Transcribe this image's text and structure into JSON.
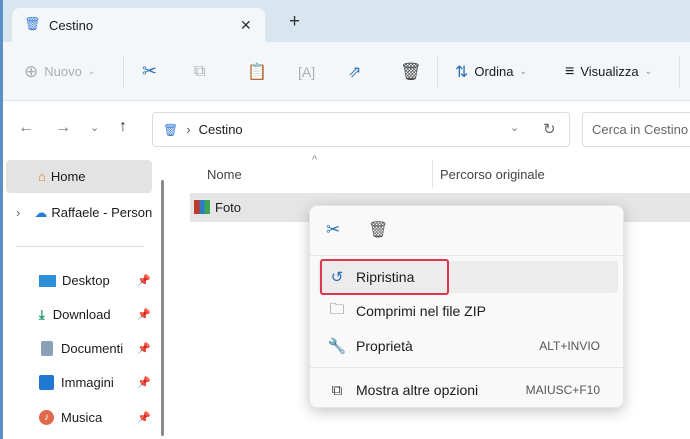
{
  "tab": {
    "title": "Cestino",
    "close": "✕",
    "new_tab": "+"
  },
  "toolbar": {
    "new_label": "Nuovo",
    "sort_label": "Ordina",
    "view_label": "Visualizza"
  },
  "address": {
    "path": "Cestino",
    "search_placeholder": "Cerca in Cestino"
  },
  "sidebar": {
    "items": [
      {
        "label": "Home"
      },
      {
        "label": "Raffaele - Personale"
      },
      {
        "label": "Desktop"
      },
      {
        "label": "Download"
      },
      {
        "label": "Documenti"
      },
      {
        "label": "Immagini"
      },
      {
        "label": "Musica"
      }
    ]
  },
  "columns": {
    "name": "Nome",
    "original_path": "Percorso originale"
  },
  "files": [
    {
      "name": "Foto"
    }
  ],
  "context_menu": {
    "items": [
      {
        "label": "Ripristina",
        "shortcut": ""
      },
      {
        "label": "Comprimi nel file ZIP",
        "shortcut": ""
      },
      {
        "label": "Proprietà",
        "shortcut": "ALT+INVIO"
      },
      {
        "label": "Mostra altre opzioni",
        "shortcut": "MAIUSC+F10"
      }
    ]
  },
  "colors": {
    "accent": "#0067c0",
    "highlight_border": "#e0344f"
  }
}
